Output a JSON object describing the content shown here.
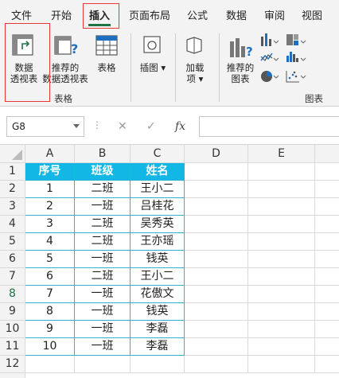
{
  "ribbon_tabs": [
    "文件",
    "开始",
    "插入",
    "页面布局",
    "公式",
    "数据",
    "审阅",
    "视图"
  ],
  "active_tab": "插入",
  "ribbon": {
    "pivot_table": "数据\n透视表",
    "recommended_pivot": "推荐的\n数据透视表",
    "table": "表格",
    "illustrations": "插图",
    "addins": "加载\n项",
    "recommended_charts": "推荐的\n图表",
    "group_tables": "表格",
    "group_charts": "图表"
  },
  "formula_bar": {
    "name_box": "G8",
    "cancel_symbol": "✕",
    "enter_symbol": "✓",
    "fx_symbol": "fx",
    "formula": ""
  },
  "grid": {
    "columns": [
      "A",
      "B",
      "C",
      "D",
      "E"
    ],
    "rows": [
      "1",
      "2",
      "3",
      "4",
      "5",
      "6",
      "7",
      "8",
      "9",
      "10",
      "11",
      "12"
    ],
    "selected_row": "8",
    "headers": [
      "序号",
      "班级",
      "姓名"
    ],
    "records": [
      [
        "1",
        "二班",
        "王小二"
      ],
      [
        "2",
        "一班",
        "吕桂花"
      ],
      [
        "3",
        "二班",
        "吴秀英"
      ],
      [
        "4",
        "二班",
        "王亦瑶"
      ],
      [
        "5",
        "一班",
        "钱英"
      ],
      [
        "6",
        "二班",
        "王小二"
      ],
      [
        "7",
        "一班",
        "花傲文"
      ],
      [
        "8",
        "一班",
        "钱英"
      ],
      [
        "9",
        "一班",
        "李磊"
      ],
      [
        "10",
        "一班",
        "李磊"
      ]
    ]
  },
  "colors": {
    "header_fill": "#12b7e6",
    "table_border": "#32b0d0",
    "excel_green": "#217346",
    "highlight_red": "#e53935"
  }
}
